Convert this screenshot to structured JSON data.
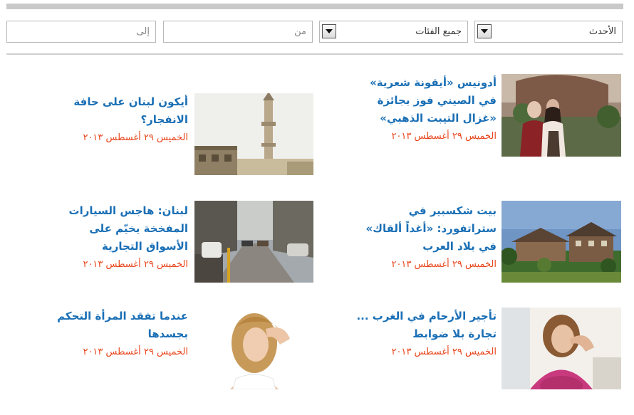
{
  "filters": {
    "sort_label": "الأحدث",
    "category_label": "جميع الفئات",
    "from_placeholder": "من",
    "to_placeholder": "إلى"
  },
  "articles": [
    {
      "title": "أدونيس «أيقونة شعرية» في الصيني فوز بجائزة «غزال التيبت الذهبي»",
      "date": "الخميس ٢٩ أغسطس ٢٠١٣"
    },
    {
      "title": "أيكون لبنان على حافة الانفجار؟",
      "date": "الخميس ٢٩ أغسطس ٢٠١٣"
    },
    {
      "title": "بيت شكسبير في ستراتفورد: «أغداً ألقاك» في بلاد العرب",
      "date": "الخميس ٢٩ أغسطس ٢٠١٣"
    },
    {
      "title": "لبنان: هاجس السيارات المفخخة يخيّم على الأسواق التجارية",
      "date": "الخميس ٢٩ أغسطس ٢٠١٣"
    },
    {
      "title": "تأجير الأرحام في الغرب ... تجارة بلا ضوابط",
      "date": "الخميس ٢٩ أغسطس ٢٠١٣"
    },
    {
      "title": "عندما تفقد المرأة التحكم بجسدها",
      "date": "الخميس ٢٩ أغسطس ٢٠١٣"
    }
  ],
  "colors": {
    "title": "#1a6fb5",
    "date": "#e8451b",
    "divider": "#cfcfcf"
  }
}
